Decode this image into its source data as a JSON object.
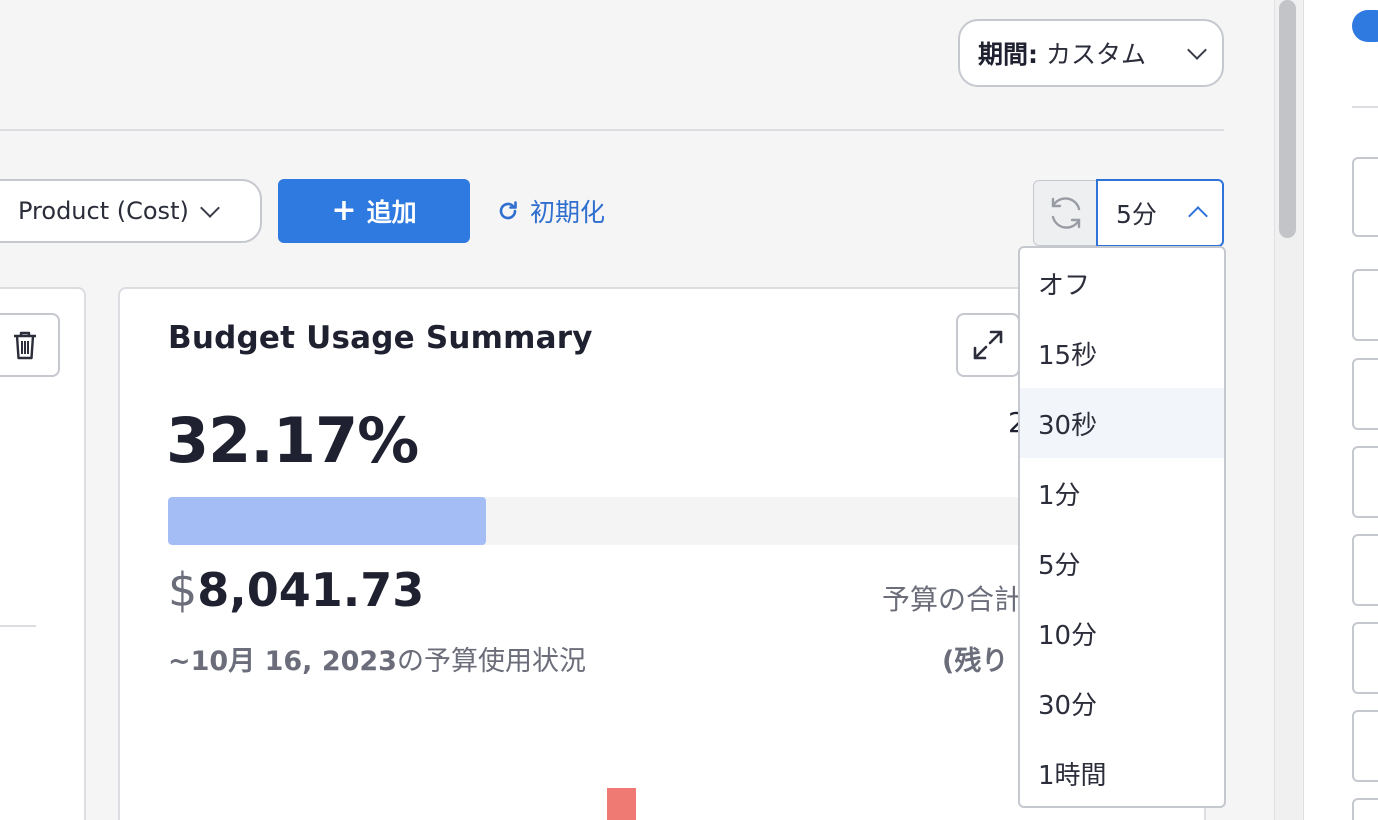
{
  "header": {
    "period_label": "期間:",
    "period_value": "カスタム"
  },
  "toolbar": {
    "group_by_value": "Product (Cost)",
    "add_label": "追加",
    "add_icon": "plus-icon",
    "reset_label": "初期化",
    "reset_icon": "reset-icon",
    "refresh_icon": "refresh-icon",
    "refresh_interval": "5分"
  },
  "refresh_dropdown": {
    "highlighted": "30秒",
    "options": [
      "オフ",
      "15秒",
      "30秒",
      "1分",
      "5分",
      "10分",
      "30分",
      "1時間"
    ]
  },
  "budget_card": {
    "title": "Budget Usage Summary",
    "usage_percent": "32.17%",
    "usage_fraction": 0.3217,
    "right_value_partial": "2",
    "currency": "$",
    "amount": "8,041.73",
    "usage_date": "~10月 16, 2023",
    "usage_suffix": "の予算使用状況",
    "total_label_partial": "予算の合計",
    "remaining_label_partial": "(残り",
    "bar_color": "#a5bdf5",
    "chart_bar_color": "#ef7a74"
  },
  "colors": {
    "accent": "#2f7ae0",
    "link": "#2f6fcf"
  }
}
